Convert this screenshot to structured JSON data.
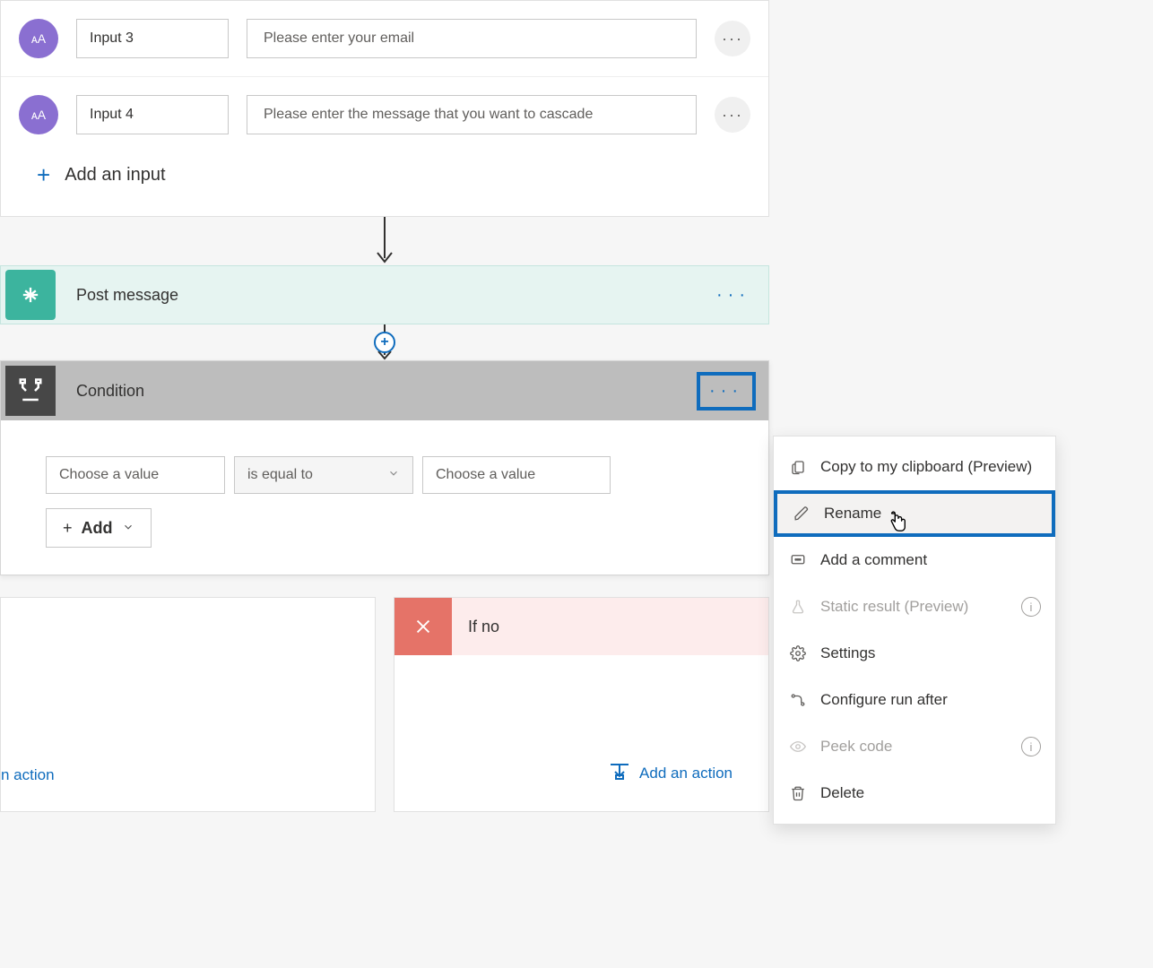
{
  "trigger": {
    "inputs": [
      {
        "name": "Input 3",
        "prompt": "Please enter your email"
      },
      {
        "name": "Input 4",
        "prompt": "Please enter the message that you want to cascade"
      }
    ],
    "add_input_label": "Add an input"
  },
  "post_message": {
    "title": "Post message"
  },
  "condition": {
    "title": "Condition",
    "left_placeholder": "Choose a value",
    "operator": "is equal to",
    "right_placeholder": "Choose a value",
    "add_label": "Add"
  },
  "branches": {
    "no_title": "If no",
    "add_action_label": "Add an action",
    "yes_add_action_fragment": "n action"
  },
  "context_menu": {
    "items": {
      "copy": "Copy to my clipboard (Preview)",
      "rename": "Rename",
      "comment": "Add a comment",
      "static_result": "Static result (Preview)",
      "settings": "Settings",
      "run_after": "Configure run after",
      "peek": "Peek code",
      "delete": "Delete"
    }
  }
}
